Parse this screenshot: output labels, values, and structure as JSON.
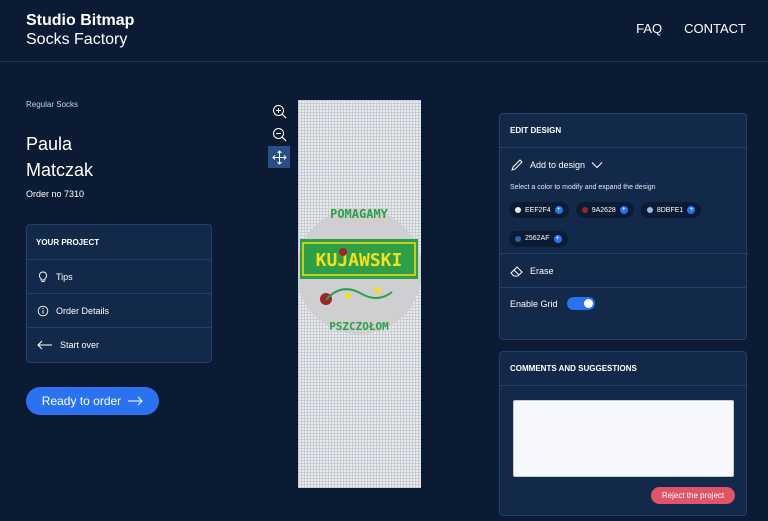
{
  "header": {
    "brand_title": "Studio Bitmap",
    "brand_subtitle": "Socks Factory",
    "nav": [
      "FAQ",
      "CONTACT"
    ]
  },
  "order": {
    "breadcrumb": "Regular Socks",
    "first_name": "Paula",
    "last_name": "Matczak",
    "order_no": "Order no 7310"
  },
  "project": {
    "title": "YOUR PROJECT",
    "items": [
      {
        "label": "Tips",
        "icon": "lightbulb-icon"
      },
      {
        "label": "Order Details",
        "icon": "info-icon"
      },
      {
        "label": "Start over",
        "icon": "arrow-left-icon"
      }
    ]
  },
  "cta": {
    "label": "Ready to order",
    "icon": "arrow-right-icon"
  },
  "tools": [
    {
      "name": "zoom-in-icon"
    },
    {
      "name": "zoom-out-icon"
    },
    {
      "name": "move-icon",
      "active": true
    }
  ],
  "design": {
    "text_top": "POMAGAMY",
    "text_brand": "KUJAWSKI",
    "text_bottom": "PSZCZOŁOM",
    "colors": {
      "circle": "#CFCFD1",
      "ring_text": "#2E9E47",
      "banner": "#2E9E47",
      "banner_text": "#F4E11C",
      "accent": "#9A2628"
    }
  },
  "edit": {
    "title": "EDIT DESIGN",
    "add_label": "Add to design",
    "hint": "Select a color to modify and expand the design",
    "colors": [
      {
        "code": "EEF2F4",
        "hex": "#EEF2F4"
      },
      {
        "code": "9A2628",
        "hex": "#9A2628"
      },
      {
        "code": "8DBFE1",
        "hex": "#8DBFE1"
      },
      {
        "code": "2562AF",
        "hex": "#2562AF"
      }
    ],
    "erase_label": "Erase",
    "grid_label": "Enable Grid",
    "grid_enabled": true
  },
  "comments": {
    "title": "COMMENTS AND SUGGESTIONS",
    "value": "",
    "reject_label": "Reject the project"
  },
  "theme": {
    "bg": "#0B1B33",
    "card": "#13294A",
    "accent": "#2A72F0",
    "danger": "#E0546A"
  }
}
